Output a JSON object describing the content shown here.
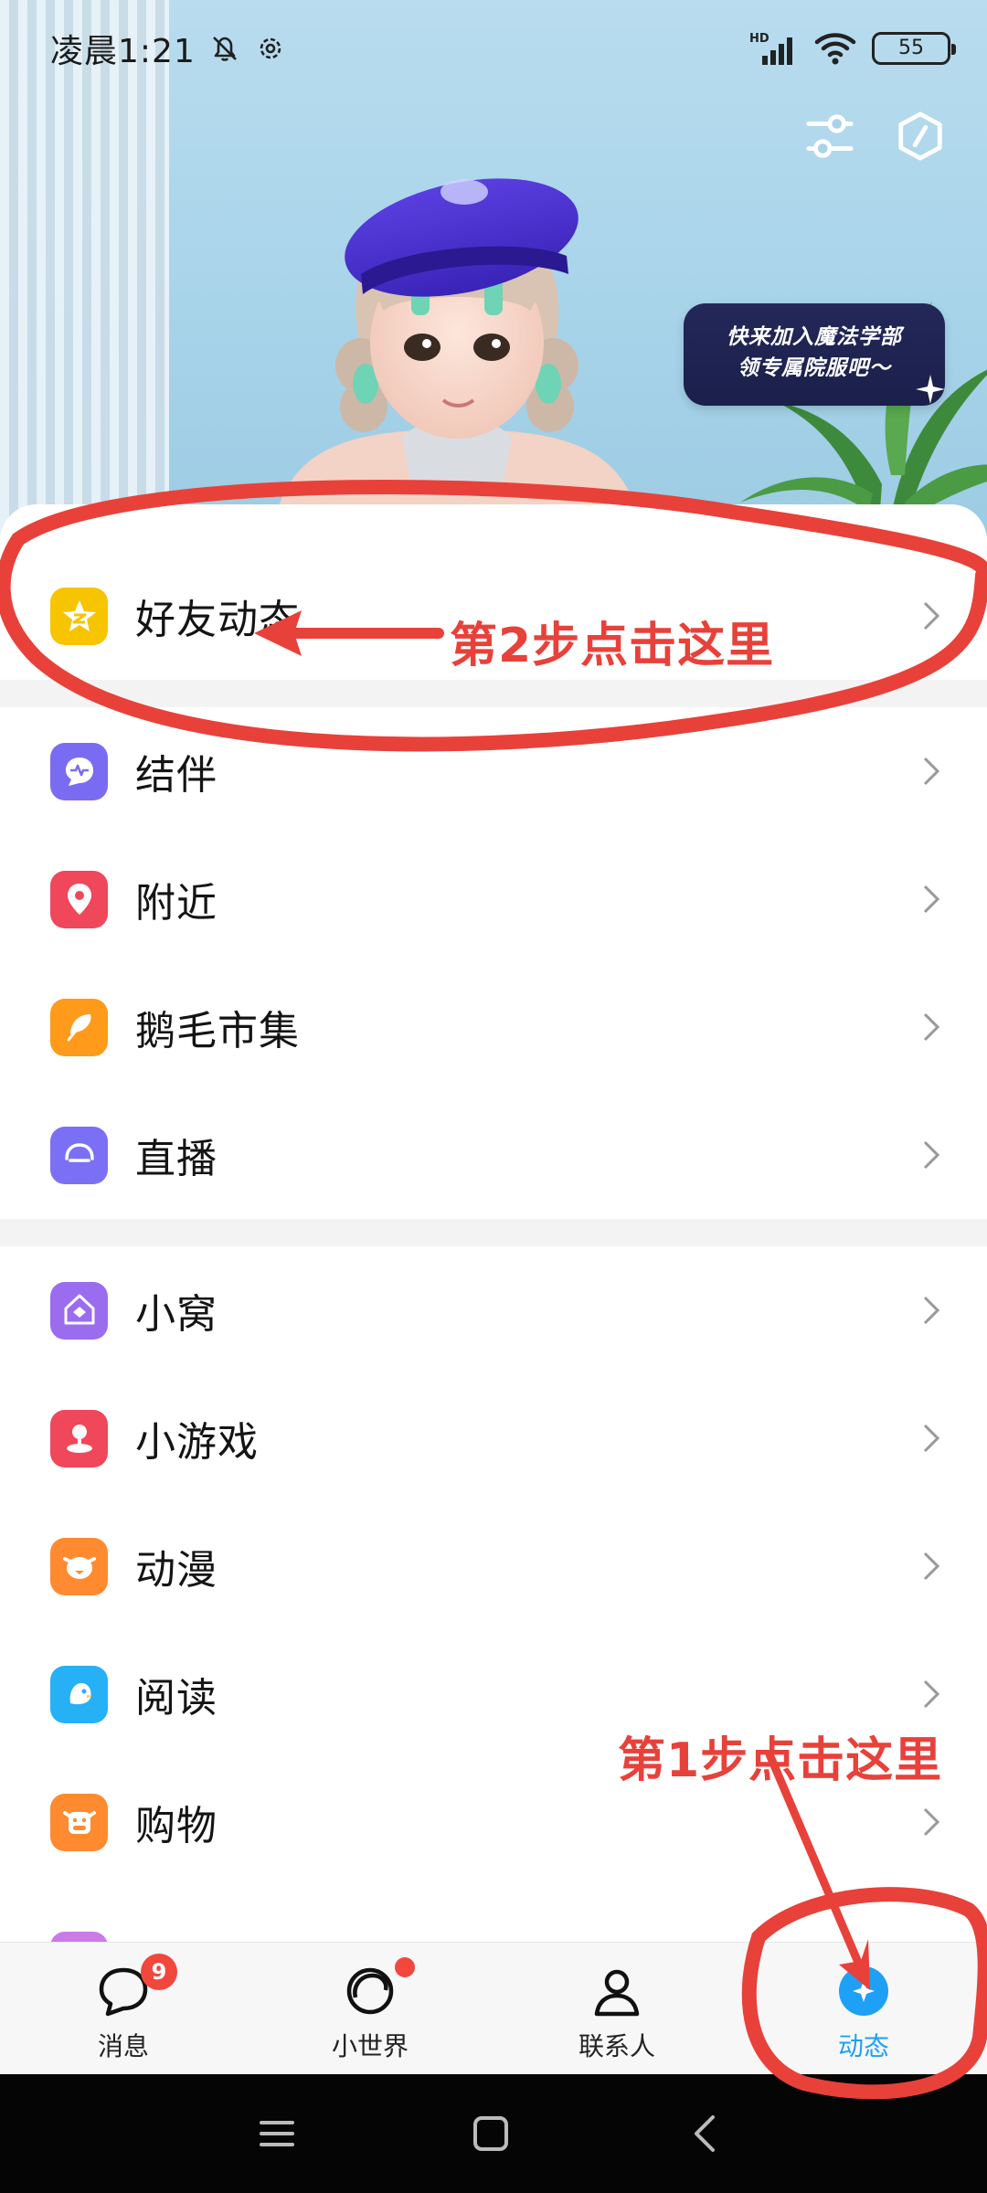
{
  "status_bar": {
    "time": "凌晨1:21",
    "network": "HD",
    "battery": "55"
  },
  "hero": {
    "promo_line1": "快来加入魔法学部",
    "promo_line2": "领专属院服吧～",
    "settings_icon": "sliders-icon",
    "action_icon": "hexagon-icon"
  },
  "menu": {
    "groups": [
      [
        {
          "label": "好友动态",
          "icon": "qzone-star-icon",
          "color": "#f7c500"
        }
      ],
      [
        {
          "label": "结伴",
          "icon": "pulse-chat-icon",
          "color": "#7a6cf2"
        },
        {
          "label": "附近",
          "icon": "location-pin-icon",
          "color": "#f0475a"
        },
        {
          "label": "鹅毛市集",
          "icon": "feather-icon",
          "color": "#ff9a1a"
        },
        {
          "label": "直播",
          "icon": "live-dome-icon",
          "color": "#7b70f5"
        }
      ],
      [
        {
          "label": "小窝",
          "icon": "home-cube-icon",
          "color": "#9a6cf0"
        },
        {
          "label": "小游戏",
          "icon": "joystick-icon",
          "color": "#f0475a"
        },
        {
          "label": "动漫",
          "icon": "cartoon-face-icon",
          "color": "#ff8a30"
        },
        {
          "label": "阅读",
          "icon": "reading-bird-icon",
          "color": "#26b0f5"
        },
        {
          "label": "购物",
          "icon": "cow-face-icon",
          "color": "#ff8a30"
        }
      ]
    ]
  },
  "bottom_nav": {
    "items": [
      {
        "label": "消息",
        "icon": "message-bubble-icon",
        "badge": "9"
      },
      {
        "label": "小世界",
        "icon": "world-ring-icon"
      },
      {
        "label": "联系人",
        "icon": "person-icon"
      },
      {
        "label": "动态",
        "icon": "star-circle-icon"
      }
    ],
    "active": "动态"
  },
  "annotations": {
    "step2": "第2步点击这里",
    "step1": "第1步点击这里",
    "color": "#e8413a"
  }
}
